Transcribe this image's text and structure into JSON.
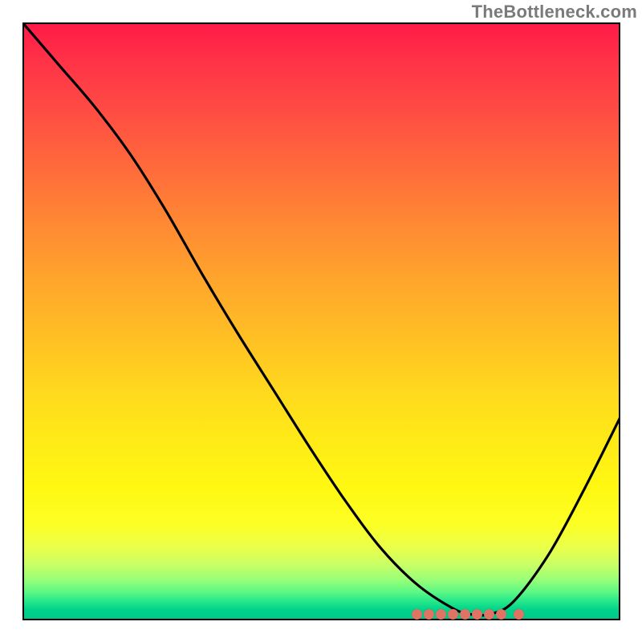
{
  "watermark": "TheBottleneck.com",
  "colors": {
    "frame": "#000000",
    "curve": "#000000",
    "marker": "#e07464",
    "watermark_text": "#7a7a7a"
  },
  "chart_data": {
    "type": "line",
    "title": "",
    "xlabel": "",
    "ylabel": "",
    "xlim": [
      0,
      100
    ],
    "ylim": [
      0,
      100
    ],
    "grid": false,
    "legend": false,
    "series": [
      {
        "name": "bottleneck-curve",
        "x": [
          0,
          6,
          12,
          18,
          24,
          30,
          36,
          42,
          48,
          54,
          60,
          66,
          72,
          75,
          78,
          82,
          88,
          94,
          100
        ],
        "y": [
          100,
          93,
          86,
          78,
          68.5,
          58,
          48,
          38.5,
          29,
          20,
          12,
          6,
          2,
          1,
          1,
          3,
          11,
          22,
          34
        ]
      }
    ],
    "markers": {
      "name": "highlight-band",
      "y": 1.0,
      "x": [
        66,
        68,
        70,
        72,
        74,
        76,
        78,
        80,
        83
      ]
    },
    "gradient_stops": [
      {
        "pos": 0.0,
        "color": "#ff1a47"
      },
      {
        "pos": 0.14,
        "color": "#ff4a44"
      },
      {
        "pos": 0.34,
        "color": "#ff8a33"
      },
      {
        "pos": 0.54,
        "color": "#ffc323"
      },
      {
        "pos": 0.78,
        "color": "#fff812"
      },
      {
        "pos": 0.91,
        "color": "#c7ff66"
      },
      {
        "pos": 0.97,
        "color": "#28e88a"
      },
      {
        "pos": 1.0,
        "color": "#00c98a"
      }
    ]
  }
}
